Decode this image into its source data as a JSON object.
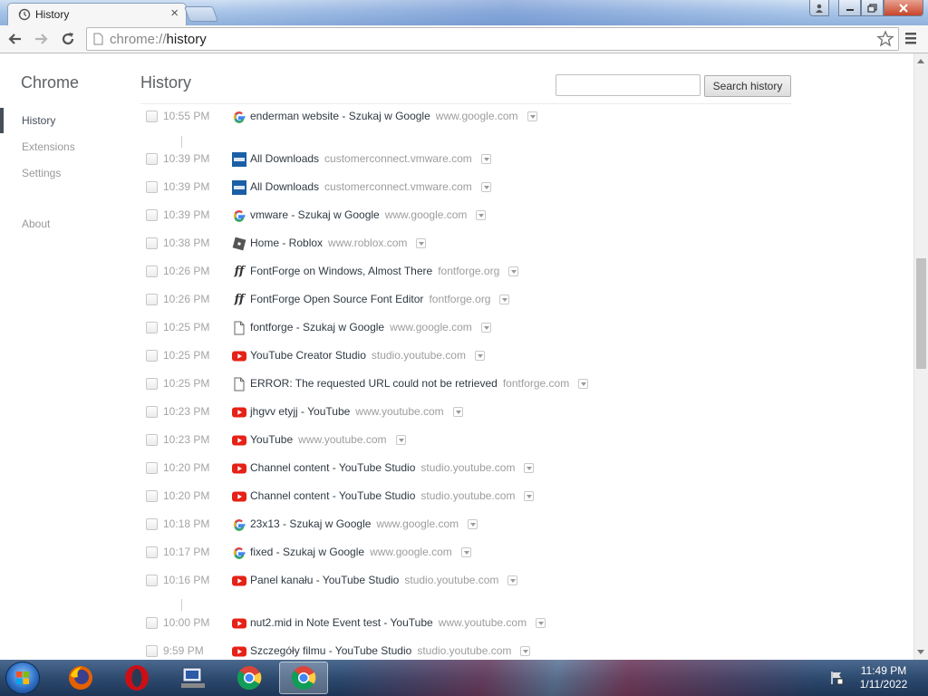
{
  "window": {
    "tab_title": "History",
    "tab_close": "×"
  },
  "toolbar": {
    "url_scheme": "chrome://",
    "url_path": "history"
  },
  "sidebar": {
    "title": "Chrome",
    "items": [
      {
        "label": "History",
        "selected": true
      },
      {
        "label": "Extensions",
        "selected": false
      },
      {
        "label": "Settings",
        "selected": false
      },
      {
        "label": "About",
        "selected": false
      }
    ]
  },
  "main": {
    "title": "History",
    "search_value": "",
    "search_button": "Search history"
  },
  "entries": [
    {
      "time": "10:55 PM",
      "title": "enderman website - Szukaj w Google",
      "domain": "www.google.com",
      "icon": "google-icon"
    },
    {
      "time": "10:39 PM",
      "title": "All Downloads",
      "domain": "customerconnect.vmware.com",
      "icon": "vmware-icon"
    },
    {
      "time": "10:39 PM",
      "title": "All Downloads",
      "domain": "customerconnect.vmware.com",
      "icon": "vmware-icon"
    },
    {
      "time": "10:39 PM",
      "title": "vmware - Szukaj w Google",
      "domain": "www.google.com",
      "icon": "google-icon"
    },
    {
      "time": "10:38 PM",
      "title": "Home - Roblox",
      "domain": "www.roblox.com",
      "icon": "roblox-icon"
    },
    {
      "time": "10:26 PM",
      "title": "FontForge on Windows, Almost There",
      "domain": "fontforge.org",
      "icon": "fontforge-icon"
    },
    {
      "time": "10:26 PM",
      "title": "FontForge Open Source Font Editor",
      "domain": "fontforge.org",
      "icon": "fontforge-icon"
    },
    {
      "time": "10:25 PM",
      "title": "fontforge - Szukaj w Google",
      "domain": "www.google.com",
      "icon": "page-icon"
    },
    {
      "time": "10:25 PM",
      "title": "YouTube Creator Studio",
      "domain": "studio.youtube.com",
      "icon": "youtube-icon"
    },
    {
      "time": "10:25 PM",
      "title": "ERROR: The requested URL could not be retrieved",
      "domain": "fontforge.com",
      "icon": "page-icon"
    },
    {
      "time": "10:23 PM",
      "title": "jhgvv etyjj - YouTube",
      "domain": "www.youtube.com",
      "icon": "youtube-icon"
    },
    {
      "time": "10:23 PM",
      "title": "YouTube",
      "domain": "www.youtube.com",
      "icon": "youtube-icon"
    },
    {
      "time": "10:20 PM",
      "title": "Channel content - YouTube Studio",
      "domain": "studio.youtube.com",
      "icon": "youtube-icon"
    },
    {
      "time": "10:20 PM",
      "title": "Channel content - YouTube Studio",
      "domain": "studio.youtube.com",
      "icon": "youtube-icon"
    },
    {
      "time": "10:18 PM",
      "title": "23x13 - Szukaj w Google",
      "domain": "www.google.com",
      "icon": "google-icon"
    },
    {
      "time": "10:17 PM",
      "title": "fixed - Szukaj w Google",
      "domain": "www.google.com",
      "icon": "google-icon"
    },
    {
      "time": "10:16 PM",
      "title": "Panel kanału - YouTube Studio",
      "domain": "studio.youtube.com",
      "icon": "youtube-icon"
    },
    {
      "time": "10:00 PM",
      "title": "nut2.mid in Note Event test - YouTube",
      "domain": "www.youtube.com",
      "icon": "youtube-icon"
    },
    {
      "time": "9:59 PM",
      "title": "Szczegóły filmu - YouTube Studio",
      "domain": "studio.youtube.com",
      "icon": "youtube-icon"
    }
  ],
  "taskbar": {
    "apps": [
      "start-button",
      "firefox-icon",
      "opera-icon",
      "network-app-icon",
      "chrome-icon",
      "chrome-icon"
    ],
    "clock_time": "11:49 PM",
    "clock_date": "1/11/2022"
  },
  "colors": {
    "accent_nav": "#464e5a",
    "text": "#303942",
    "muted": "#9d9d9d"
  }
}
